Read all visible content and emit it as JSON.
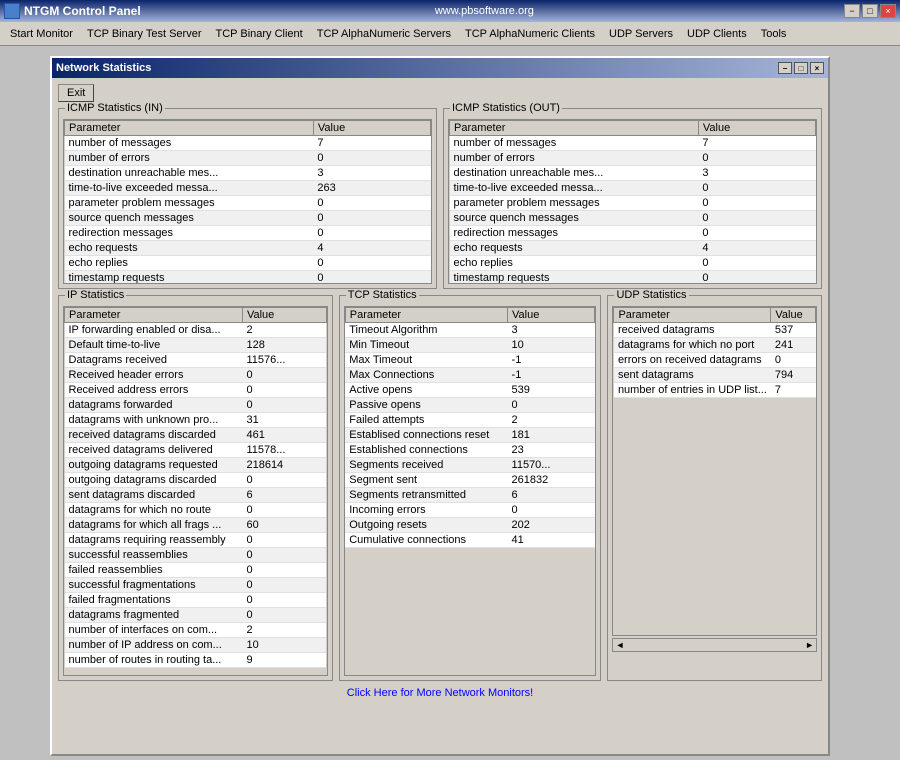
{
  "app": {
    "title": "NTGM Control Panel",
    "url": "www.pbsoftware.org",
    "icon": "monitor-icon"
  },
  "menu": {
    "items": [
      "Start Monitor",
      "TCP Binary Test Server",
      "TCP Binary Client",
      "TCP AlphaNumeric Servers",
      "TCP AlphaNumeric Clients",
      "UDP Servers",
      "UDP Clients",
      "Tools"
    ]
  },
  "inner_window": {
    "title": "Network Statistics",
    "exit_label": "Exit"
  },
  "icmp_in": {
    "label": "ICMP Statistics (IN)",
    "columns": [
      "Parameter",
      "Value"
    ],
    "rows": [
      [
        "number of messages",
        "7"
      ],
      [
        "number of errors",
        "0"
      ],
      [
        "destination unreachable mes...",
        "3"
      ],
      [
        "time-to-live exceeded messa...",
        "263"
      ],
      [
        "parameter problem messages",
        "0"
      ],
      [
        "source quench messages",
        "0"
      ],
      [
        "redirection messages",
        "0"
      ],
      [
        "echo requests",
        "4"
      ],
      [
        "echo replies",
        "0"
      ],
      [
        "timestamp requests",
        "0"
      ]
    ]
  },
  "icmp_out": {
    "label": "ICMP Statistics (OUT)",
    "columns": [
      "Parameter",
      "Value"
    ],
    "rows": [
      [
        "number of messages",
        "7"
      ],
      [
        "number of errors",
        "0"
      ],
      [
        "destination unreachable mes...",
        "3"
      ],
      [
        "time-to-live exceeded messa...",
        "0"
      ],
      [
        "parameter problem messages",
        "0"
      ],
      [
        "source quench messages",
        "0"
      ],
      [
        "redirection messages",
        "0"
      ],
      [
        "echo requests",
        "4"
      ],
      [
        "echo replies",
        "0"
      ],
      [
        "timestamp requests",
        "0"
      ]
    ]
  },
  "ip_stats": {
    "label": "IP Statistics",
    "columns": [
      "Parameter",
      "Value"
    ],
    "rows": [
      [
        "IP forwarding enabled or disa...",
        "2"
      ],
      [
        "Default time-to-live",
        "128"
      ],
      [
        "Datagrams received",
        "11576..."
      ],
      [
        "Received header errors",
        "0"
      ],
      [
        "Received address errors",
        "0"
      ],
      [
        "datagrams forwarded",
        "0"
      ],
      [
        "datagrams with unknown pro...",
        "31"
      ],
      [
        "received datagrams discarded",
        "461"
      ],
      [
        "received datagrams delivered",
        "11578..."
      ],
      [
        "outgoing datagrams requested",
        "218614"
      ],
      [
        "outgoing datagrams discarded",
        "0"
      ],
      [
        "sent datagrams discarded",
        "6"
      ],
      [
        "datagrams for which no route",
        "0"
      ],
      [
        "datagrams for which all frags ...",
        "60"
      ],
      [
        "datagrams requiring reassembly",
        "0"
      ],
      [
        "successful reassemblies",
        "0"
      ],
      [
        "failed reassemblies",
        "0"
      ],
      [
        "successful fragmentations",
        "0"
      ],
      [
        "failed fragmentations",
        "0"
      ],
      [
        "datagrams fragmented",
        "0"
      ],
      [
        "number of interfaces on com...",
        "2"
      ],
      [
        "number of IP address on com...",
        "10"
      ],
      [
        "number of routes in routing ta...",
        "9"
      ]
    ]
  },
  "tcp_stats": {
    "label": "TCP Statistics",
    "columns": [
      "Parameter",
      "Value"
    ],
    "rows": [
      [
        "Timeout Algorithm",
        "3"
      ],
      [
        "Min Timeout",
        "10"
      ],
      [
        "Max Timeout",
        "-1"
      ],
      [
        "Max Connections",
        "-1"
      ],
      [
        "Active opens",
        "539"
      ],
      [
        "Passive opens",
        "0"
      ],
      [
        "Failed attempts",
        "2"
      ],
      [
        "Establised connections reset",
        "181"
      ],
      [
        "Established connections",
        "23"
      ],
      [
        "Segments received",
        "11570..."
      ],
      [
        "Segment sent",
        "261832"
      ],
      [
        "Segments retransmitted",
        "6"
      ],
      [
        "Incoming errors",
        "0"
      ],
      [
        "Outgoing resets",
        "202"
      ],
      [
        "Cumulative connections",
        "41"
      ]
    ]
  },
  "udp_stats": {
    "label": "UDP Statistics",
    "columns": [
      "Parameter",
      "Value"
    ],
    "rows": [
      [
        "received datagrams",
        "537"
      ],
      [
        "datagrams for which no port",
        "241"
      ],
      [
        "errors on received datagrams",
        "0"
      ],
      [
        "sent datagrams",
        "794"
      ],
      [
        "number of entries in UDP list...",
        "7"
      ]
    ]
  },
  "footer": {
    "link_text": "Click Here for More Network Monitors!"
  },
  "title_bar_controls": {
    "minimize": "−",
    "maximize": "□",
    "close": "×"
  }
}
